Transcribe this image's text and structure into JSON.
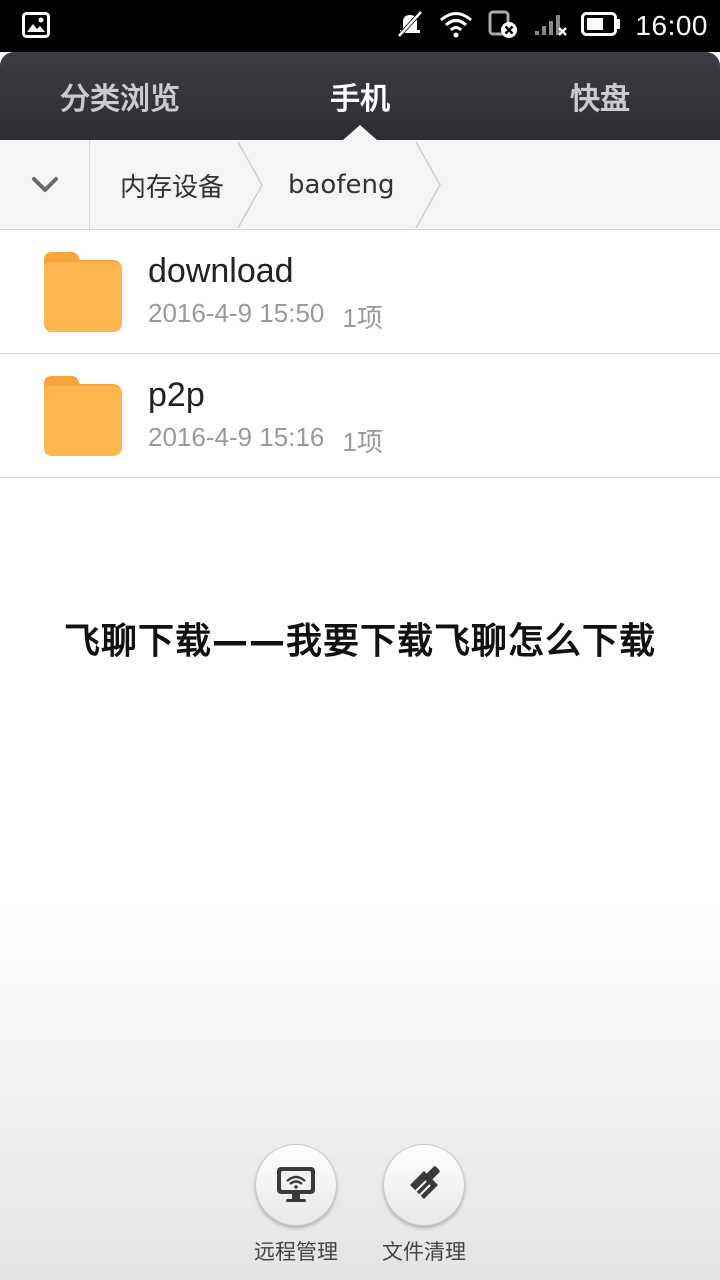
{
  "status_bar": {
    "time": "16:00",
    "icons": [
      "image-notification-icon",
      "mute-icon",
      "wifi-icon",
      "sim-blocked-icon",
      "signal-icon",
      "battery-icon"
    ]
  },
  "tabs": [
    {
      "label": "分类浏览",
      "active": false
    },
    {
      "label": "手机",
      "active": true
    },
    {
      "label": "快盘",
      "active": false
    }
  ],
  "breadcrumb": {
    "items": [
      "内存设备",
      "baofeng"
    ]
  },
  "files": [
    {
      "name": "download",
      "date": "2016-4-9 15:50",
      "count": "1项"
    },
    {
      "name": "p2p",
      "date": "2016-4-9 15:16",
      "count": "1项"
    }
  ],
  "headline": "飞聊下载——我要下载飞聊怎么下载",
  "tools": [
    {
      "label": "远程管理",
      "icon": "remote-monitor-icon"
    },
    {
      "label": "文件清理",
      "icon": "broom-icon"
    }
  ],
  "colors": {
    "folder": "#fbb04a",
    "tabbar": "#33363b",
    "breadcrumb_bg": "#f5f5f5"
  }
}
